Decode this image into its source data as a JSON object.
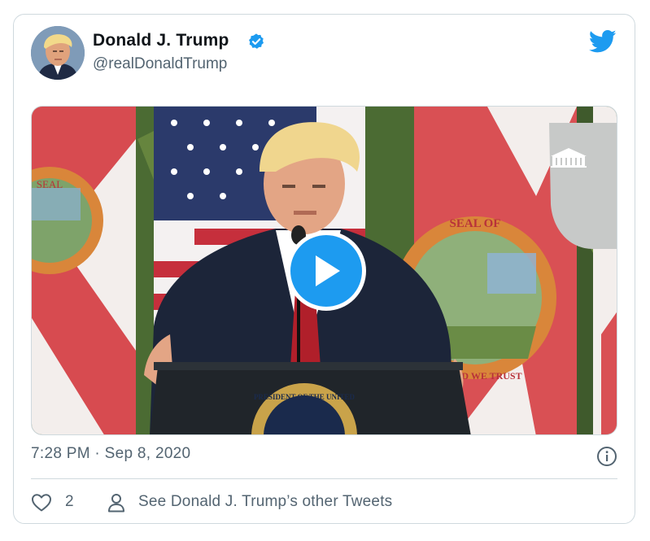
{
  "tweet": {
    "author_name": "Donald J. Trump",
    "author_handle": "@realDonaldTrump",
    "timestamp": "7:28 PM · Sep 8, 2020",
    "like_count": "2",
    "see_more_label": "See Donald J. Trump’s other Tweets"
  },
  "media": {
    "seal_text_top": "GREAT SEAL OF",
    "seal_text_bottom": "IN GOD WE TRUST",
    "podium_text": "PRESIDENT OF THE UNITED"
  },
  "icons": {
    "verified": "verified-badge-icon",
    "bird": "twitter-bird-icon",
    "play": "play-icon",
    "info": "info-icon",
    "like": "heart-icon",
    "person": "person-icon"
  },
  "colors": {
    "accent": "#1d9bf0",
    "secondary_text": "#536471",
    "border": "#cfd9de"
  }
}
